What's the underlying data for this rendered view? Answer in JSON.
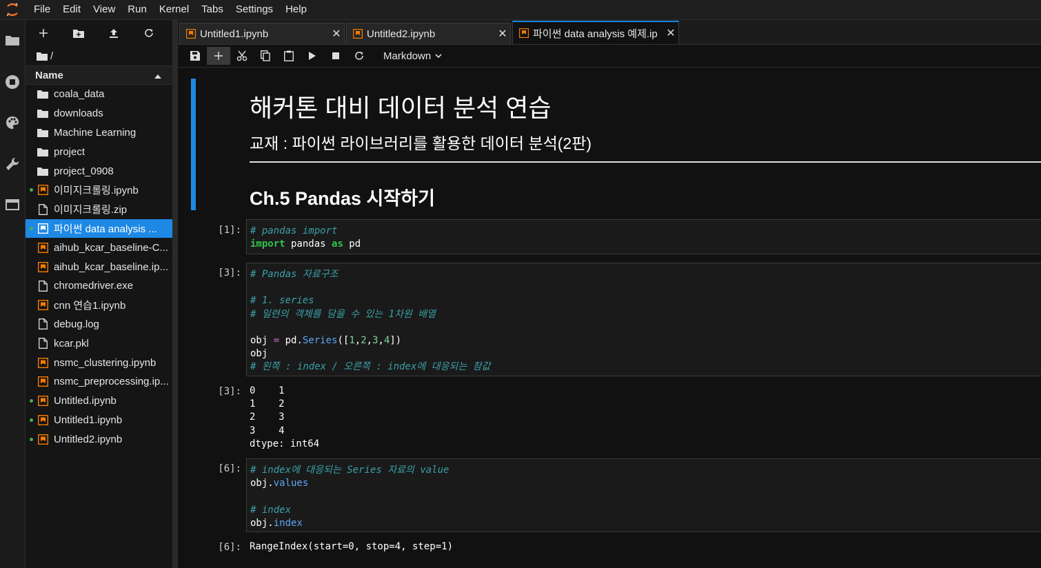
{
  "menubar": {
    "items": [
      "File",
      "Edit",
      "View",
      "Run",
      "Kernel",
      "Tabs",
      "Settings",
      "Help"
    ]
  },
  "activitybar": {
    "icons": [
      "folder-icon",
      "running-icon",
      "palette-icon",
      "wrench-icon",
      "tabs-icon"
    ]
  },
  "filebrowser": {
    "breadcrumb": "/",
    "header_label": "Name",
    "items": [
      {
        "name": "coala_data",
        "type": "folder",
        "running": false
      },
      {
        "name": "downloads",
        "type": "folder",
        "running": false
      },
      {
        "name": "Machine Learning",
        "type": "folder",
        "running": false
      },
      {
        "name": "project",
        "type": "folder",
        "running": false
      },
      {
        "name": "project_0908",
        "type": "folder",
        "running": false
      },
      {
        "name": "이미지크롤링.ipynb",
        "type": "notebook",
        "running": true
      },
      {
        "name": "이미지크롤링.zip",
        "type": "file",
        "running": false
      },
      {
        "name": "파이썬 data analysis ...",
        "type": "notebook",
        "running": true,
        "selected": true
      },
      {
        "name": "aihub_kcar_baseline-C...",
        "type": "notebook",
        "running": false
      },
      {
        "name": "aihub_kcar_baseline.ip...",
        "type": "notebook",
        "running": false
      },
      {
        "name": "chromedriver.exe",
        "type": "file",
        "running": false
      },
      {
        "name": "cnn 연습1.ipynb",
        "type": "notebook",
        "running": false
      },
      {
        "name": "debug.log",
        "type": "file",
        "running": false
      },
      {
        "name": "kcar.pkl",
        "type": "file",
        "running": false
      },
      {
        "name": "nsmc_clustering.ipynb",
        "type": "notebook",
        "running": false
      },
      {
        "name": "nsmc_preprocessing.ip...",
        "type": "notebook",
        "running": false
      },
      {
        "name": "Untitled.ipynb",
        "type": "notebook",
        "running": true
      },
      {
        "name": "Untitled1.ipynb",
        "type": "notebook",
        "running": true
      },
      {
        "name": "Untitled2.ipynb",
        "type": "notebook",
        "running": true
      }
    ]
  },
  "tabs": [
    {
      "label": "Untitled1.ipynb",
      "active": false
    },
    {
      "label": "Untitled2.ipynb",
      "active": false
    },
    {
      "label": "파이썬 data analysis 예제.ip",
      "active": true
    }
  ],
  "toolbar": {
    "cell_type": "Markdown"
  },
  "notebook": {
    "markdown": {
      "h1": "해커톤 대비 데이터 분석 연습",
      "h2": "교재 : 파이썬 라이브러리를 활용한 데이터 분석(2판)",
      "h3": "Ch.5 Pandas 시작하기"
    },
    "cells": [
      {
        "prompt": "[1]:",
        "kind": "input"
      },
      {
        "prompt": "[3]:",
        "kind": "input"
      },
      {
        "prompt": "[3]:",
        "kind": "output"
      },
      {
        "prompt": "[6]:",
        "kind": "input"
      },
      {
        "prompt": "[6]:",
        "kind": "output"
      }
    ],
    "code": {
      "c1_comment": "# pandas import",
      "c1_import": "import",
      "c1_pandas": " pandas ",
      "c1_as": "as",
      "c1_pd": " pd",
      "c2_l1": "# Pandas 자료구조",
      "c2_l3": "# 1. series",
      "c2_l4": "# 일련의 객체를 담을 수 있는 1차원 배열",
      "c2_obj": "obj ",
      "c2_eq": "=",
      "c2_pd": " pd.",
      "c2_series": "Series",
      "c2_open": "([",
      "c2_n1": "1",
      "c2_n2": "2",
      "c2_n3": "3",
      "c2_n4": "4",
      "c2_comma": ",",
      "c2_close": "])",
      "c2_obj2": "obj",
      "c2_l8": "# 왼쪽 : index / 오른쪽 : index에 대응되는 참값",
      "c3_l1": "# index에 대응되는 Series 자료의 value",
      "c3_obj": "obj.",
      "c3_values": "values",
      "c3_l4": "# index",
      "c3_index": "index"
    },
    "outputs": {
      "series": "0    1\n1    2\n2    3\n3    4\ndtype: int64",
      "range_index": "RangeIndex(start=0, stop=4, step=1)"
    }
  }
}
